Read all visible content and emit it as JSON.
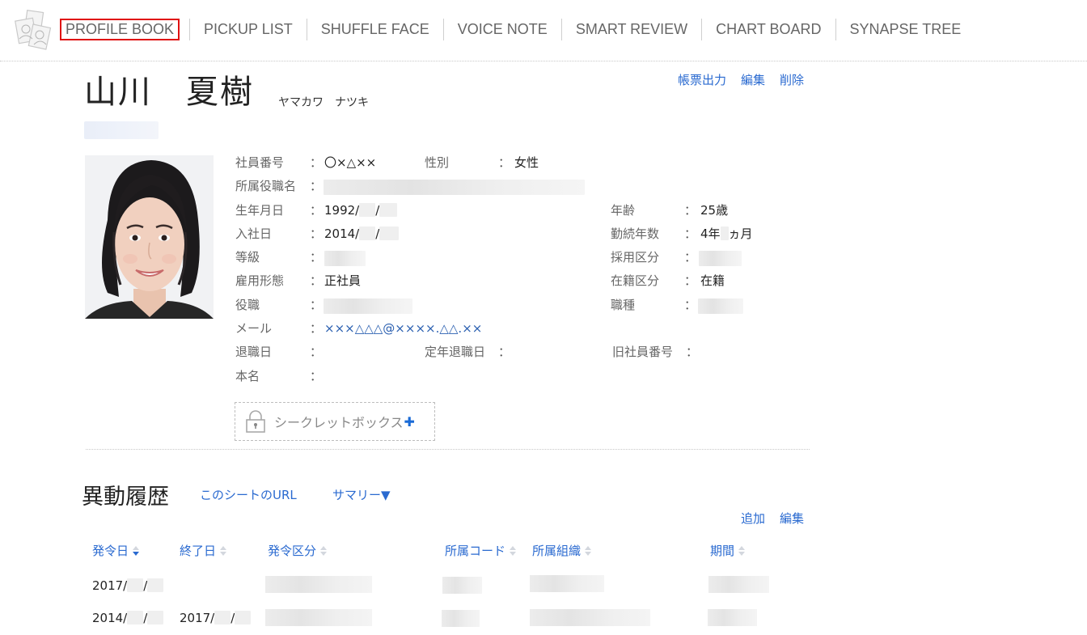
{
  "nav": {
    "logo_icon": "photo-stack-icon",
    "items": [
      {
        "label": "PROFILE BOOK",
        "active": true
      },
      {
        "label": "PICKUP LIST"
      },
      {
        "label": "SHUFFLE FACE"
      },
      {
        "label": "VOICE NOTE"
      },
      {
        "label": "SMART REVIEW"
      },
      {
        "label": "CHART BOARD"
      },
      {
        "label": "SYNAPSE TREE"
      }
    ]
  },
  "profile": {
    "name": "山川　夏樹",
    "kana": "ヤマカワ　ナツキ",
    "actions": {
      "export": "帳票出力",
      "edit": "編集",
      "delete": "削除"
    },
    "photo_icon": "profile-photo",
    "fields": {
      "employee_no": {
        "label": "社員番号",
        "value": "〇×△××"
      },
      "gender": {
        "label": "性別",
        "value": "女性"
      },
      "affiliation_title": {
        "label": "所属役職名",
        "value": ""
      },
      "birthdate": {
        "label": "生年月日",
        "value_prefix": "1992/",
        "value_sep": "/"
      },
      "age": {
        "label": "年齢",
        "value": "25歳"
      },
      "join_date": {
        "label": "入社日",
        "value_prefix": "2014/",
        "value_sep": "/"
      },
      "tenure": {
        "label": "勤続年数",
        "value_prefix": "4年",
        "value_suffix": "ヵ月"
      },
      "grade": {
        "label": "等級",
        "value": ""
      },
      "hire_type": {
        "label": "採用区分",
        "value": ""
      },
      "employment_type": {
        "label": "雇用形態",
        "value": "正社員"
      },
      "status": {
        "label": "在籍区分",
        "value": "在籍"
      },
      "position": {
        "label": "役職",
        "value": ""
      },
      "job_type": {
        "label": "職種",
        "value": ""
      },
      "email": {
        "label": "メール",
        "value": "×××△△△@××××.△△.××"
      },
      "retire_date": {
        "label": "退職日",
        "value": ""
      },
      "mandatory_retire_date": {
        "label": "定年退職日",
        "value": ""
      },
      "old_employee_no": {
        "label": "旧社員番号",
        "value": ""
      },
      "real_name": {
        "label": "本名",
        "value": ""
      }
    },
    "colon": "：",
    "secret_box": {
      "label": "シークレットボックス",
      "plus": "✚"
    }
  },
  "history": {
    "title": "異動履歴",
    "sheet_url": "このシートのURL",
    "summary": "サマリー▼",
    "actions": {
      "add": "追加",
      "edit": "編集"
    },
    "columns": [
      {
        "label": "発令日",
        "sorted": "desc"
      },
      {
        "label": "終了日"
      },
      {
        "label": "発令区分"
      },
      {
        "label": "所属コード"
      },
      {
        "label": "所属組織"
      },
      {
        "label": "期間"
      }
    ],
    "rows": [
      {
        "start_prefix": "2017/",
        "start_sep": "/",
        "end_prefix": "",
        "end_sep": ""
      },
      {
        "start_prefix": "2014/",
        "start_sep": "/",
        "end_prefix": "2017/",
        "end_sep": "/"
      }
    ]
  }
}
